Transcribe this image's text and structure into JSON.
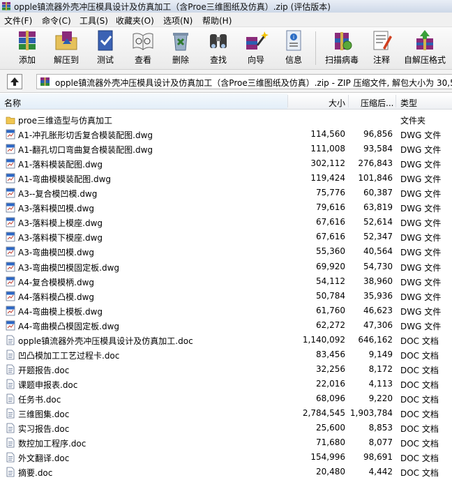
{
  "window": {
    "title": "opple镇流器外壳冲压模具设计及仿真加工（含Proe三维图纸及仿真）.zip (评估版本)"
  },
  "menu": [
    "文件(F)",
    "命令(C)",
    "工具(S)",
    "收藏夹(O)",
    "选项(N)",
    "帮助(H)"
  ],
  "toolbar": {
    "add": "添加",
    "extract_to": "解压到",
    "test": "测试",
    "view": "查看",
    "delete": "删除",
    "find": "查找",
    "wizard": "向导",
    "info": "信息",
    "scan": "扫描病毒",
    "comment": "注释",
    "sfx": "自解压格式"
  },
  "address": {
    "path": "opple镇流器外壳冲压模具设计及仿真加工（含Proe三维图纸及仿真）.zip - ZIP 压缩文件, 解包大小为 30,5"
  },
  "columns": {
    "name": "名称",
    "size": "大小",
    "packed": "压缩后...",
    "type": "类型"
  },
  "files": [
    {
      "name": "proe三维造型与仿真加工",
      "size": "",
      "packed": "",
      "type": "文件夹",
      "kind": "folder"
    },
    {
      "name": "A1-冲孔胀形切舌复合模装配图.dwg",
      "size": "114,560",
      "packed": "96,856",
      "type": "DWG 文件",
      "kind": "dwg"
    },
    {
      "name": "A1-翻孔切口弯曲复合模装配图.dwg",
      "size": "111,008",
      "packed": "93,584",
      "type": "DWG 文件",
      "kind": "dwg"
    },
    {
      "name": "A1-落料模装配图.dwg",
      "size": "302,112",
      "packed": "276,843",
      "type": "DWG 文件",
      "kind": "dwg"
    },
    {
      "name": "A1-弯曲模模装配图.dwg",
      "size": "119,424",
      "packed": "101,846",
      "type": "DWG 文件",
      "kind": "dwg"
    },
    {
      "name": "A3--复合模凹模.dwg",
      "size": "75,776",
      "packed": "60,387",
      "type": "DWG 文件",
      "kind": "dwg"
    },
    {
      "name": "A3-落料模凹模.dwg",
      "size": "79,616",
      "packed": "63,819",
      "type": "DWG 文件",
      "kind": "dwg"
    },
    {
      "name": "A3-落料模上模座.dwg",
      "size": "67,616",
      "packed": "52,614",
      "type": "DWG 文件",
      "kind": "dwg"
    },
    {
      "name": "A3-落料模下模座.dwg",
      "size": "67,616",
      "packed": "52,347",
      "type": "DWG 文件",
      "kind": "dwg"
    },
    {
      "name": "A3-弯曲模凹模.dwg",
      "size": "55,360",
      "packed": "40,564",
      "type": "DWG 文件",
      "kind": "dwg"
    },
    {
      "name": "A3-弯曲模凹模固定板.dwg",
      "size": "69,920",
      "packed": "54,730",
      "type": "DWG 文件",
      "kind": "dwg"
    },
    {
      "name": "A4-复合模模柄.dwg",
      "size": "54,112",
      "packed": "38,960",
      "type": "DWG 文件",
      "kind": "dwg"
    },
    {
      "name": "A4-落料模凸模.dwg",
      "size": "50,784",
      "packed": "35,936",
      "type": "DWG 文件",
      "kind": "dwg"
    },
    {
      "name": "A4-弯曲模上模板.dwg",
      "size": "61,760",
      "packed": "46,623",
      "type": "DWG 文件",
      "kind": "dwg"
    },
    {
      "name": "A4-弯曲模凸模固定板.dwg",
      "size": "62,272",
      "packed": "47,306",
      "type": "DWG 文件",
      "kind": "dwg"
    },
    {
      "name": "opple镇流器外壳冲压模具设计及仿真加工.doc",
      "size": "1,140,092",
      "packed": "646,162",
      "type": "DOC 文档",
      "kind": "doc"
    },
    {
      "name": "凹凸模加工工艺过程卡.doc",
      "size": "83,456",
      "packed": "9,149",
      "type": "DOC 文档",
      "kind": "doc"
    },
    {
      "name": "开题报告.doc",
      "size": "32,256",
      "packed": "8,172",
      "type": "DOC 文档",
      "kind": "doc"
    },
    {
      "name": "课题申报表.doc",
      "size": "22,016",
      "packed": "4,113",
      "type": "DOC 文档",
      "kind": "doc"
    },
    {
      "name": "任务书.doc",
      "size": "68,096",
      "packed": "9,220",
      "type": "DOC 文档",
      "kind": "doc"
    },
    {
      "name": "三维图集.doc",
      "size": "2,784,545",
      "packed": "1,903,784",
      "type": "DOC 文档",
      "kind": "doc"
    },
    {
      "name": "实习报告.doc",
      "size": "25,600",
      "packed": "8,853",
      "type": "DOC 文档",
      "kind": "doc"
    },
    {
      "name": "数控加工程序.doc",
      "size": "71,680",
      "packed": "8,077",
      "type": "DOC 文档",
      "kind": "doc"
    },
    {
      "name": "外文翻译.doc",
      "size": "154,996",
      "packed": "98,691",
      "type": "DOC 文档",
      "kind": "doc"
    },
    {
      "name": "摘要.doc",
      "size": "20,480",
      "packed": "4,442",
      "type": "DOC 文档",
      "kind": "doc"
    }
  ]
}
